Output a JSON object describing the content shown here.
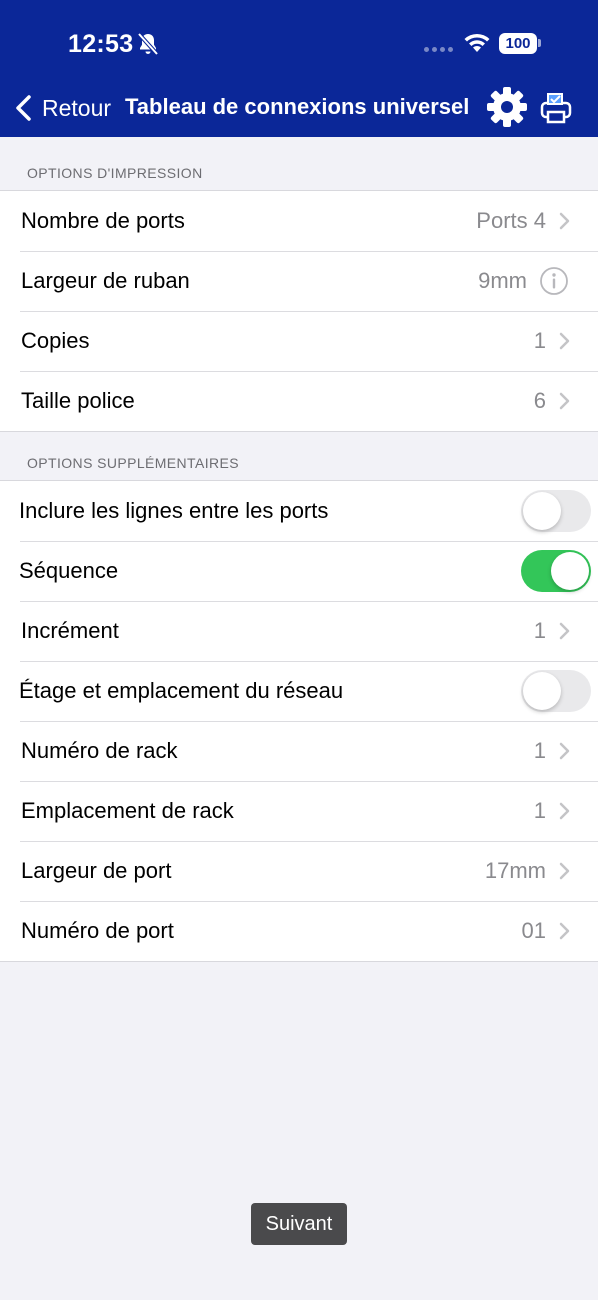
{
  "status_bar": {
    "time": "12:53",
    "battery": "100",
    "icons": [
      "bell-off-icon",
      "signal-dots-icon",
      "wifi-icon",
      "battery-icon"
    ]
  },
  "nav": {
    "back_label": "Retour",
    "title": "Tableau de connexions universel",
    "icons": [
      "chevron-left-icon",
      "gear-icon",
      "printer-icon"
    ],
    "bar_color": "#0b2798"
  },
  "print_options": {
    "header": "OPTIONS D'IMPRESSION",
    "rows": [
      {
        "label": "Nombre de ports",
        "value": "Ports 4"
      },
      {
        "label": "Largeur de ruban",
        "value": "9mm"
      },
      {
        "label": "Copies",
        "value": "1"
      },
      {
        "label": "Taille police",
        "value": "6"
      }
    ]
  },
  "extra_options": {
    "header": "OPTIONS SUPPLÉMENTAIRES",
    "rows": [
      {
        "label": "Inclure les lignes entre les ports",
        "toggle": false
      },
      {
        "label": "Séquence",
        "toggle": true
      },
      {
        "label": "Incrément",
        "value": "1"
      },
      {
        "label": "Étage et emplacement du réseau",
        "toggle": false
      },
      {
        "label": "Numéro de rack",
        "value": "1"
      },
      {
        "label": "Emplacement de rack",
        "value": "1"
      },
      {
        "label": "Largeur de port",
        "value": "17mm"
      },
      {
        "label": "Numéro de port",
        "value": "01"
      }
    ]
  },
  "toast": {
    "label": "Suivant"
  },
  "colors": {
    "toggle_on": "#33c659",
    "background": "#f2f2f7"
  }
}
